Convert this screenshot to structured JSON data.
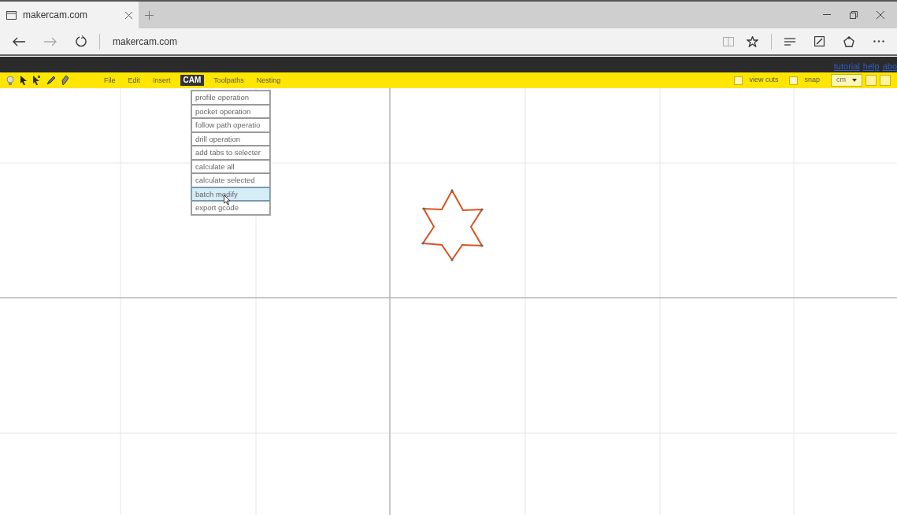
{
  "browser": {
    "tab_title": "makercam.com",
    "address": "makercam.com"
  },
  "top_links": [
    {
      "label": "tutorial"
    },
    {
      "label": "help"
    },
    {
      "label": "abo"
    }
  ],
  "menubar": [
    {
      "label": "File",
      "selected": false
    },
    {
      "label": "Edit",
      "selected": false
    },
    {
      "label": "Insert",
      "selected": false
    },
    {
      "label": "CAM",
      "selected": true
    },
    {
      "label": "Toolpaths",
      "selected": false
    },
    {
      "label": "Nesting",
      "selected": false
    }
  ],
  "options": [
    {
      "label": "view cuts",
      "checked": false
    },
    {
      "label": "snap",
      "checked": false
    }
  ],
  "units": {
    "value": "cm"
  },
  "cam_menu": [
    {
      "label": "profile operation",
      "selected": false
    },
    {
      "label": "pocket operation",
      "selected": false
    },
    {
      "label": "follow path operatio",
      "selected": false
    },
    {
      "label": "drill operation",
      "selected": false
    },
    {
      "label": "add tabs to selecter",
      "selected": false
    },
    {
      "label": "calculate all",
      "selected": false
    },
    {
      "label": "calculate selected",
      "selected": false
    },
    {
      "label": "batch modify",
      "selected": true
    },
    {
      "label": "export gcode",
      "selected": false
    }
  ]
}
